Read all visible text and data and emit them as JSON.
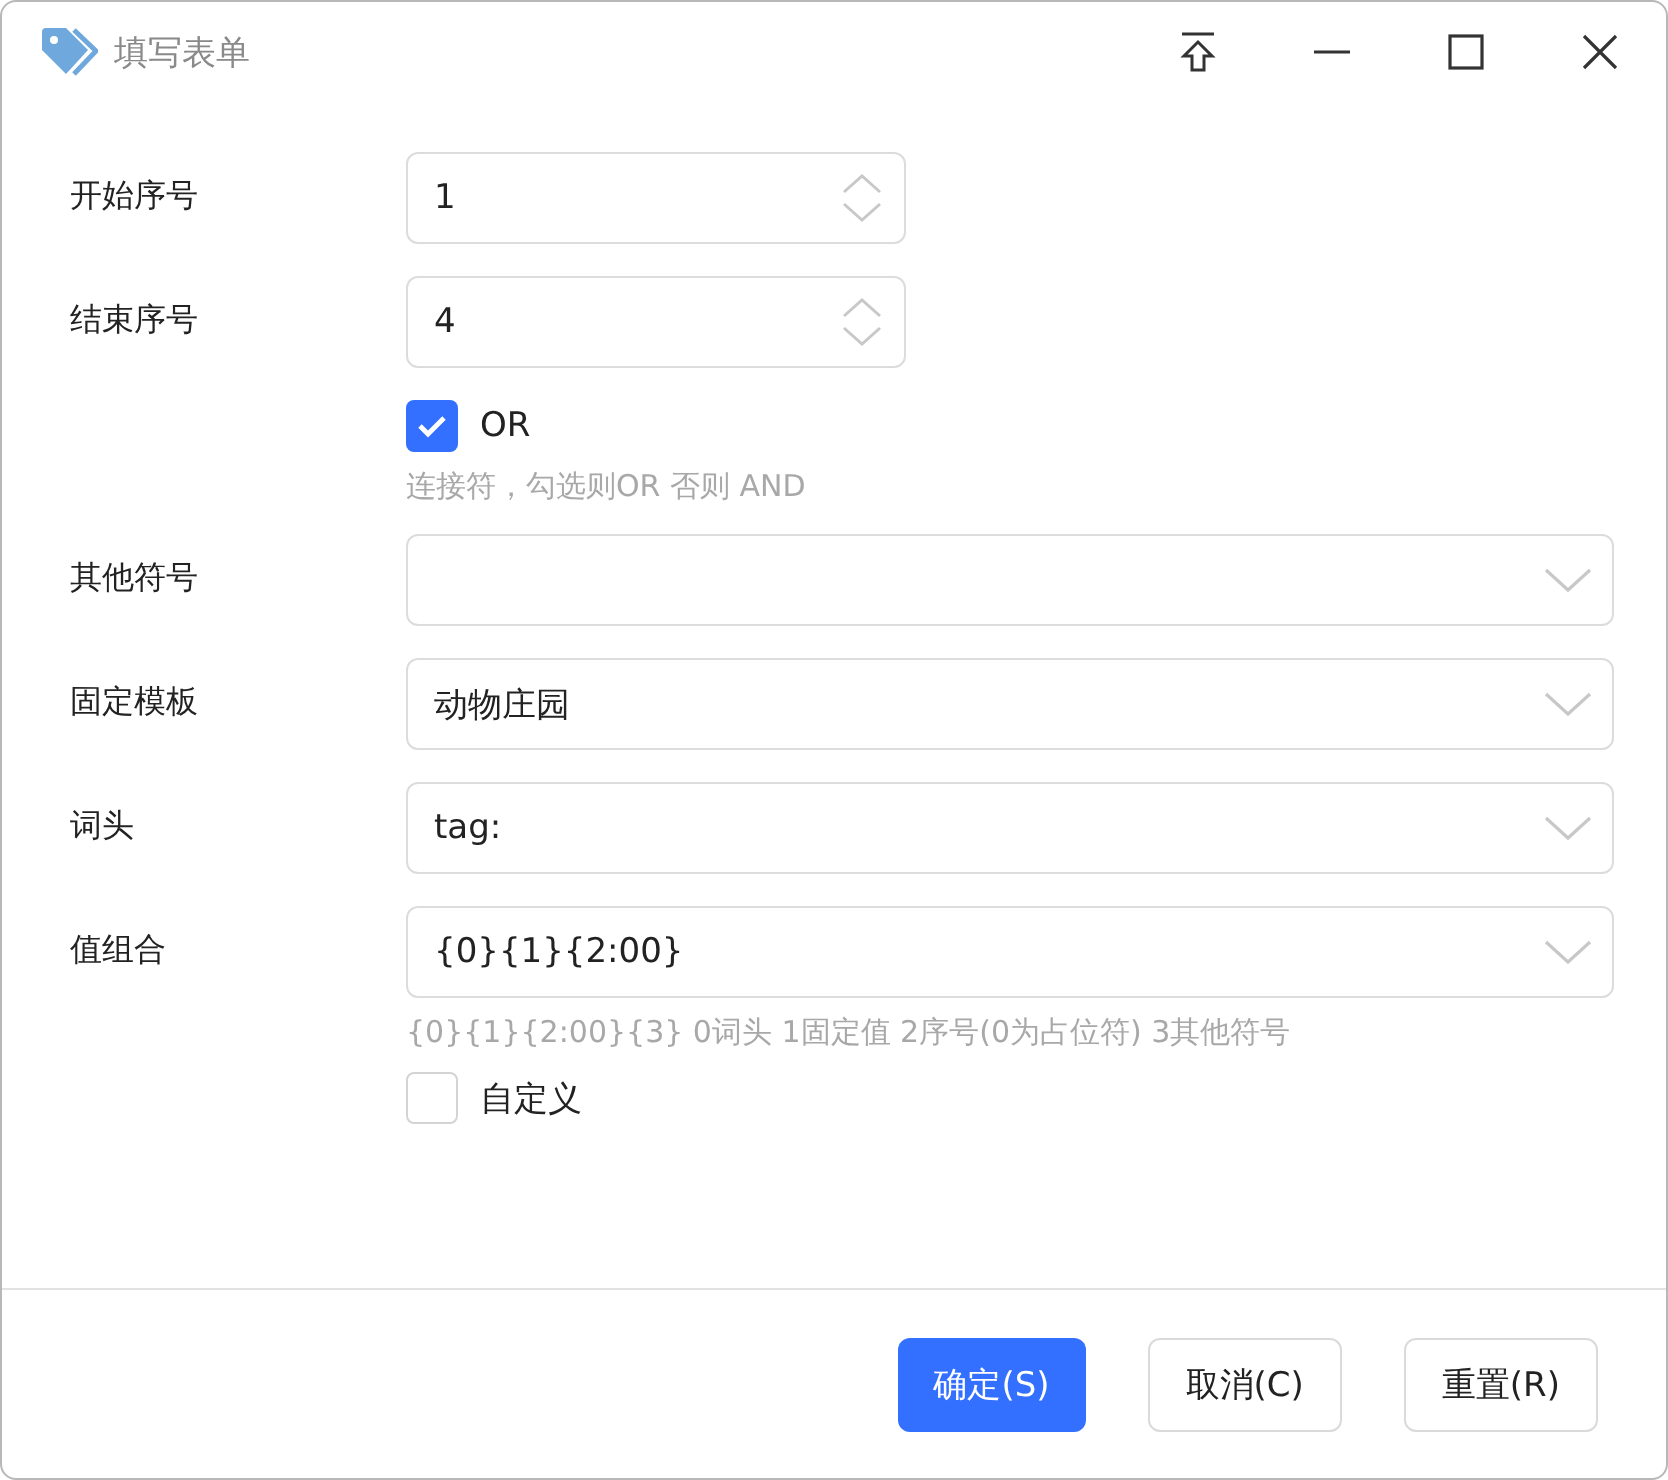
{
  "window": {
    "title": "填写表单"
  },
  "rows": [
    {
      "kind": "spin",
      "label": "开始序号",
      "value": "1"
    },
    {
      "kind": "spin",
      "label": "结束序号",
      "value": "4"
    },
    {
      "kind": "checkbox",
      "text": "OR",
      "checked": true,
      "hint": "连接符，勾选则OR 否则 AND"
    },
    {
      "kind": "select",
      "label": "其他符号"
    },
    {
      "kind": "select",
      "label": "固定模板",
      "value": "动物庄园"
    },
    {
      "kind": "select",
      "label": "词头",
      "value": "tag:"
    },
    {
      "kind": "select",
      "label": "值组合",
      "value": "{0}{1}{2:00}",
      "hint": "{0}{1}{2:00}{3}  0词头 1固定值 2序号(0为占位符) 3其他符号"
    },
    {
      "kind": "checkbox",
      "text": "自定义",
      "checked": false
    }
  ],
  "buttons": [
    {
      "label": "确定(S)",
      "primary": true
    },
    {
      "label": "取消(C)",
      "primary": false
    },
    {
      "label": "重置(R)",
      "primary": false
    }
  ]
}
